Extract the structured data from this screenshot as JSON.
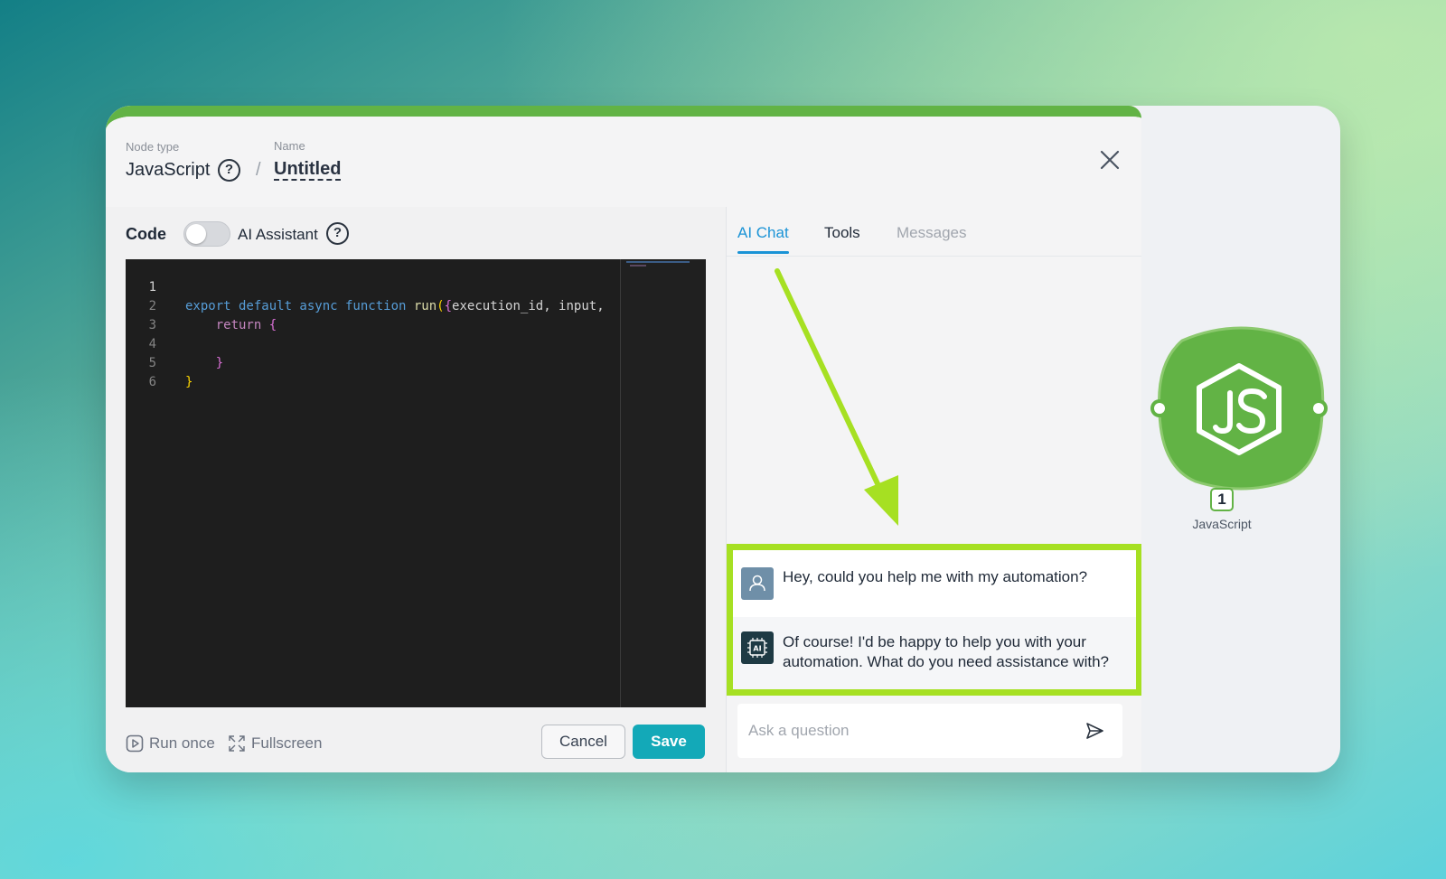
{
  "header": {
    "node_type_label": "Node type",
    "node_type_value": "JavaScript",
    "help_glyph": "?",
    "separator": "/",
    "name_label": "Name",
    "name_value": "Untitled"
  },
  "editor_toolbar": {
    "code_label": "Code",
    "ai_assistant_label": "AI Assistant",
    "ai_assistant_enabled": false
  },
  "code": {
    "line_numbers": [
      "1",
      "2",
      "3",
      "4",
      "5",
      "6"
    ],
    "active_line": 1,
    "lines": [
      "export default async function run({execution_id, input,",
      "    return {",
      "",
      "    }",
      "}",
      ""
    ]
  },
  "footer": {
    "run_once_label": "Run once",
    "fullscreen_label": "Fullscreen",
    "cancel_label": "Cancel",
    "save_label": "Save"
  },
  "tabs": [
    {
      "label": "AI Chat",
      "state": "active"
    },
    {
      "label": "Tools",
      "state": "normal"
    },
    {
      "label": "Messages",
      "state": "disabled"
    }
  ],
  "chat": {
    "messages": [
      {
        "role": "user",
        "icon": "user-icon",
        "text": "Hey, could you help me with my automation?"
      },
      {
        "role": "assistant",
        "icon": "ai-chip-icon",
        "text": "Of course! I'd be happy to help you with your automation. What do you need assistance with?"
      }
    ],
    "input_placeholder": "Ask a question"
  },
  "node": {
    "icon": "javascript-icon",
    "badge": "1",
    "label": "JavaScript"
  },
  "colors": {
    "accent_green": "#62b345",
    "highlight_lime": "#a6e022",
    "save_button": "#13a9b8",
    "active_tab": "#1a93d6"
  }
}
